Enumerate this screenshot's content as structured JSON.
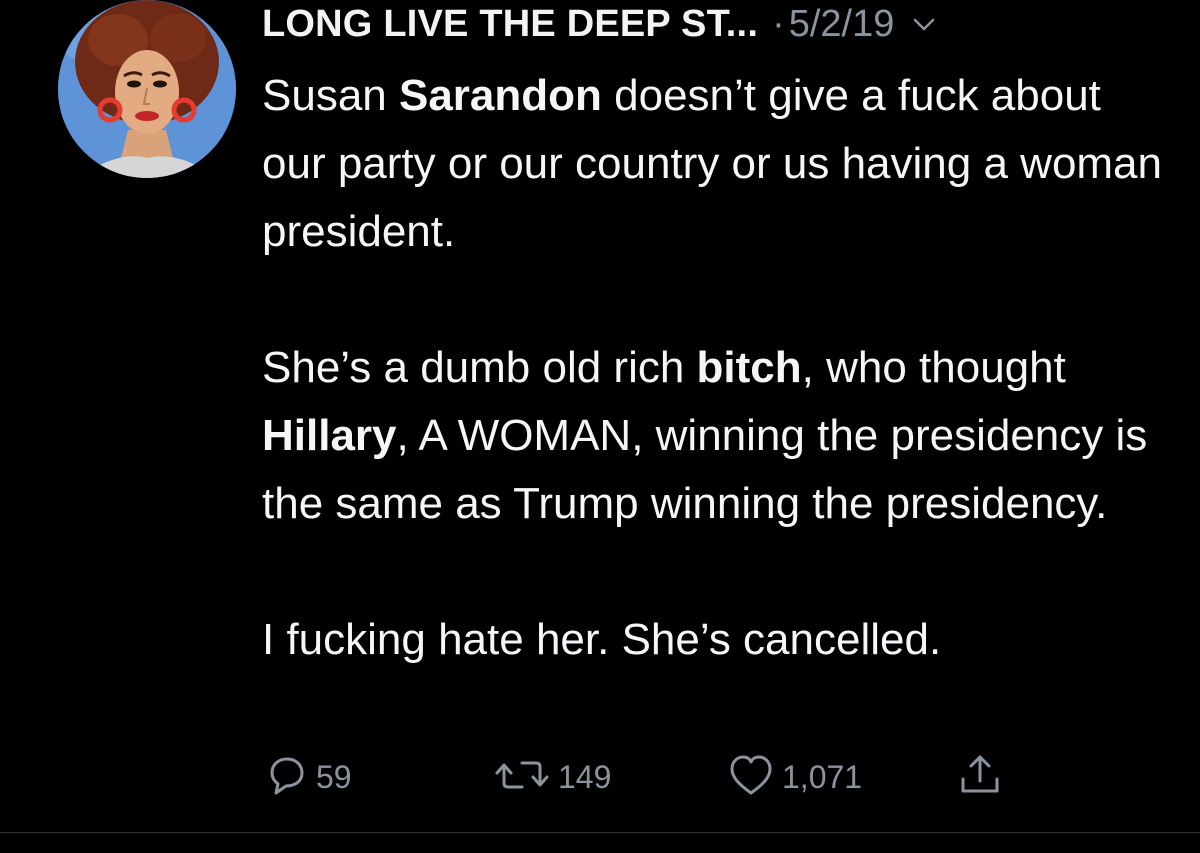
{
  "tweet": {
    "author_name": "LONG LIVE THE DEEP ST...",
    "separator": "·",
    "date": "5/2/19",
    "body": {
      "p1": {
        "part1": "Susan ",
        "bold1": "Sarandon",
        "part2": " doesn’t give a fuck about our party or our country or us having a woman president."
      },
      "p2": {
        "part1": "She’s a dumb old rich ",
        "bold1": "bitch",
        "part2": ", who thought ",
        "bold2": "Hillary",
        "part3": ", A WOMAN, winning the presidency is the same as Trump winning the presidency."
      },
      "p3": "I fucking hate her. She’s cancelled."
    },
    "actions": {
      "reply": {
        "icon": "reply-icon",
        "count": "59"
      },
      "retweet": {
        "icon": "retweet-icon",
        "count": "149"
      },
      "like": {
        "icon": "heart-icon",
        "count": "1,071"
      },
      "share": {
        "icon": "share-icon"
      }
    }
  },
  "colors": {
    "background": "#000000",
    "text": "#f5f6f7",
    "secondary": "#8b949e",
    "divider": "#2f3336"
  }
}
